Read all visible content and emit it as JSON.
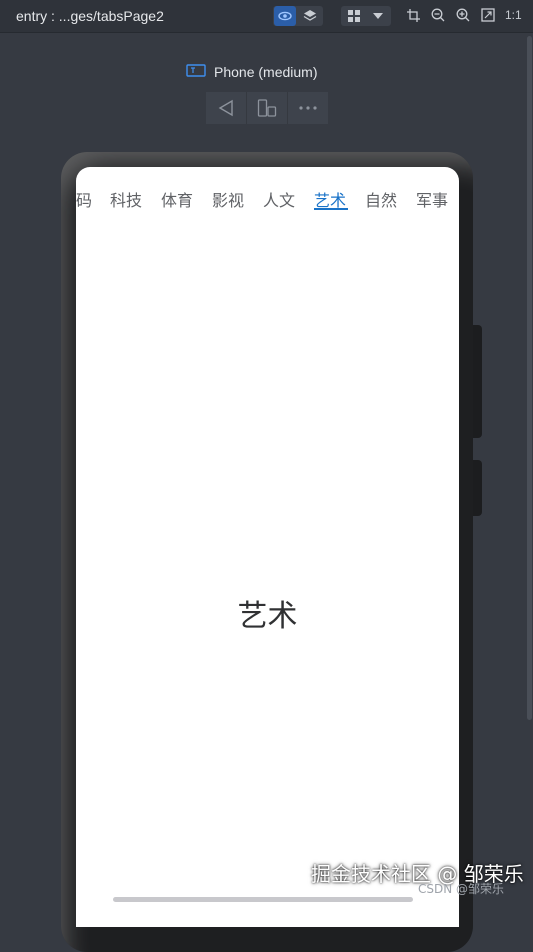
{
  "toolbar": {
    "title": "entry : ...ges/tabsPage2",
    "ratio_label": "1:1",
    "icons": [
      "eye-icon",
      "layers-icon",
      "grid-icon",
      "dropdown-icon",
      "crop-icon",
      "zoom-out-icon",
      "zoom-in-icon",
      "fit-screen-icon"
    ]
  },
  "device": {
    "label": "Phone (medium)"
  },
  "controls": {
    "icons": [
      "back-triangle-icon",
      "rotate-device-icon",
      "more-icon"
    ]
  },
  "tabs": [
    {
      "label": "码",
      "active": false
    },
    {
      "label": "科技",
      "active": false
    },
    {
      "label": "体育",
      "active": false
    },
    {
      "label": "影视",
      "active": false
    },
    {
      "label": "人文",
      "active": false
    },
    {
      "label": "艺术",
      "active": true
    },
    {
      "label": "自然",
      "active": false
    },
    {
      "label": "军事",
      "active": false
    }
  ],
  "content": {
    "text": "艺术"
  },
  "watermark": {
    "main": "掘金技术社区 @ 邹荣乐",
    "sub": "CSDN @邹荣乐"
  },
  "colors": {
    "accent": "#1a73c8",
    "background": "#363a42",
    "screen": "#ffffff"
  }
}
